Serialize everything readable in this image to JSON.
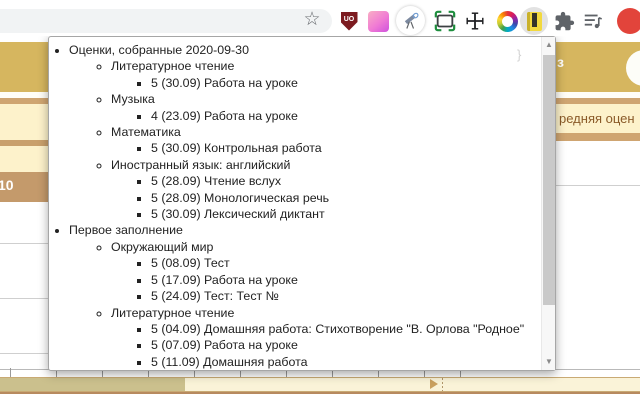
{
  "toolbar": {
    "bookmark_star": "☆",
    "ublock_label": "UO",
    "scroll_up": "▲",
    "scroll_down": "▼",
    "icons": [
      "bookmark-star",
      "ublock-origin",
      "color-swatch",
      "telescope",
      "screenshot-frame",
      "move-tool",
      "color-wheel",
      "notebook-extension",
      "extensions-puzzle",
      "playlist-music",
      "profile-avatar"
    ]
  },
  "page": {
    "header_text_fragment": "з",
    "average_grade_fragment": "редняя оцен",
    "date_header_fragment": "10"
  },
  "popup": {
    "scroll_hint": "}",
    "groups": [
      {
        "title": "Оценки, собранные 2020-09-30",
        "subjects": [
          {
            "name": "Литературное чтение",
            "marks": [
              "5 (30.09) Работа на уроке"
            ]
          },
          {
            "name": "Музыка",
            "marks": [
              "4 (23.09) Работа на уроке"
            ]
          },
          {
            "name": "Математика",
            "marks": [
              "5 (30.09) Контрольная работа"
            ]
          },
          {
            "name": "Иностранный язык: английский",
            "marks": [
              "5 (28.09) Чтение вслух",
              "5 (28.09) Монологическая речь",
              "5 (30.09) Лексический диктант"
            ]
          }
        ]
      },
      {
        "title": "Первое заполнение",
        "subjects": [
          {
            "name": "Окружающий мир",
            "marks": [
              "5 (08.09) Тест",
              "5 (17.09) Работа на уроке",
              "5 (24.09) Тест: Тест №"
            ]
          },
          {
            "name": "Литературное чтение",
            "marks": [
              "5 (04.09) Домашняя работа: Стихотворение \"В. Орлова \"Родное\"",
              "5 (07.09) Работа на уроке",
              "5 (11.09) Домашняя работа"
            ]
          }
        ]
      }
    ]
  },
  "colors": {
    "gold_header": "#d6b65f",
    "cream_band": "#fdf2cb",
    "tan_band": "#cfa571",
    "brown_rule": "#b78a5f",
    "active_icon_yellow": "#f2d93e",
    "ublock_red": "#7c1b20",
    "avatar_red": "#e2443b"
  }
}
